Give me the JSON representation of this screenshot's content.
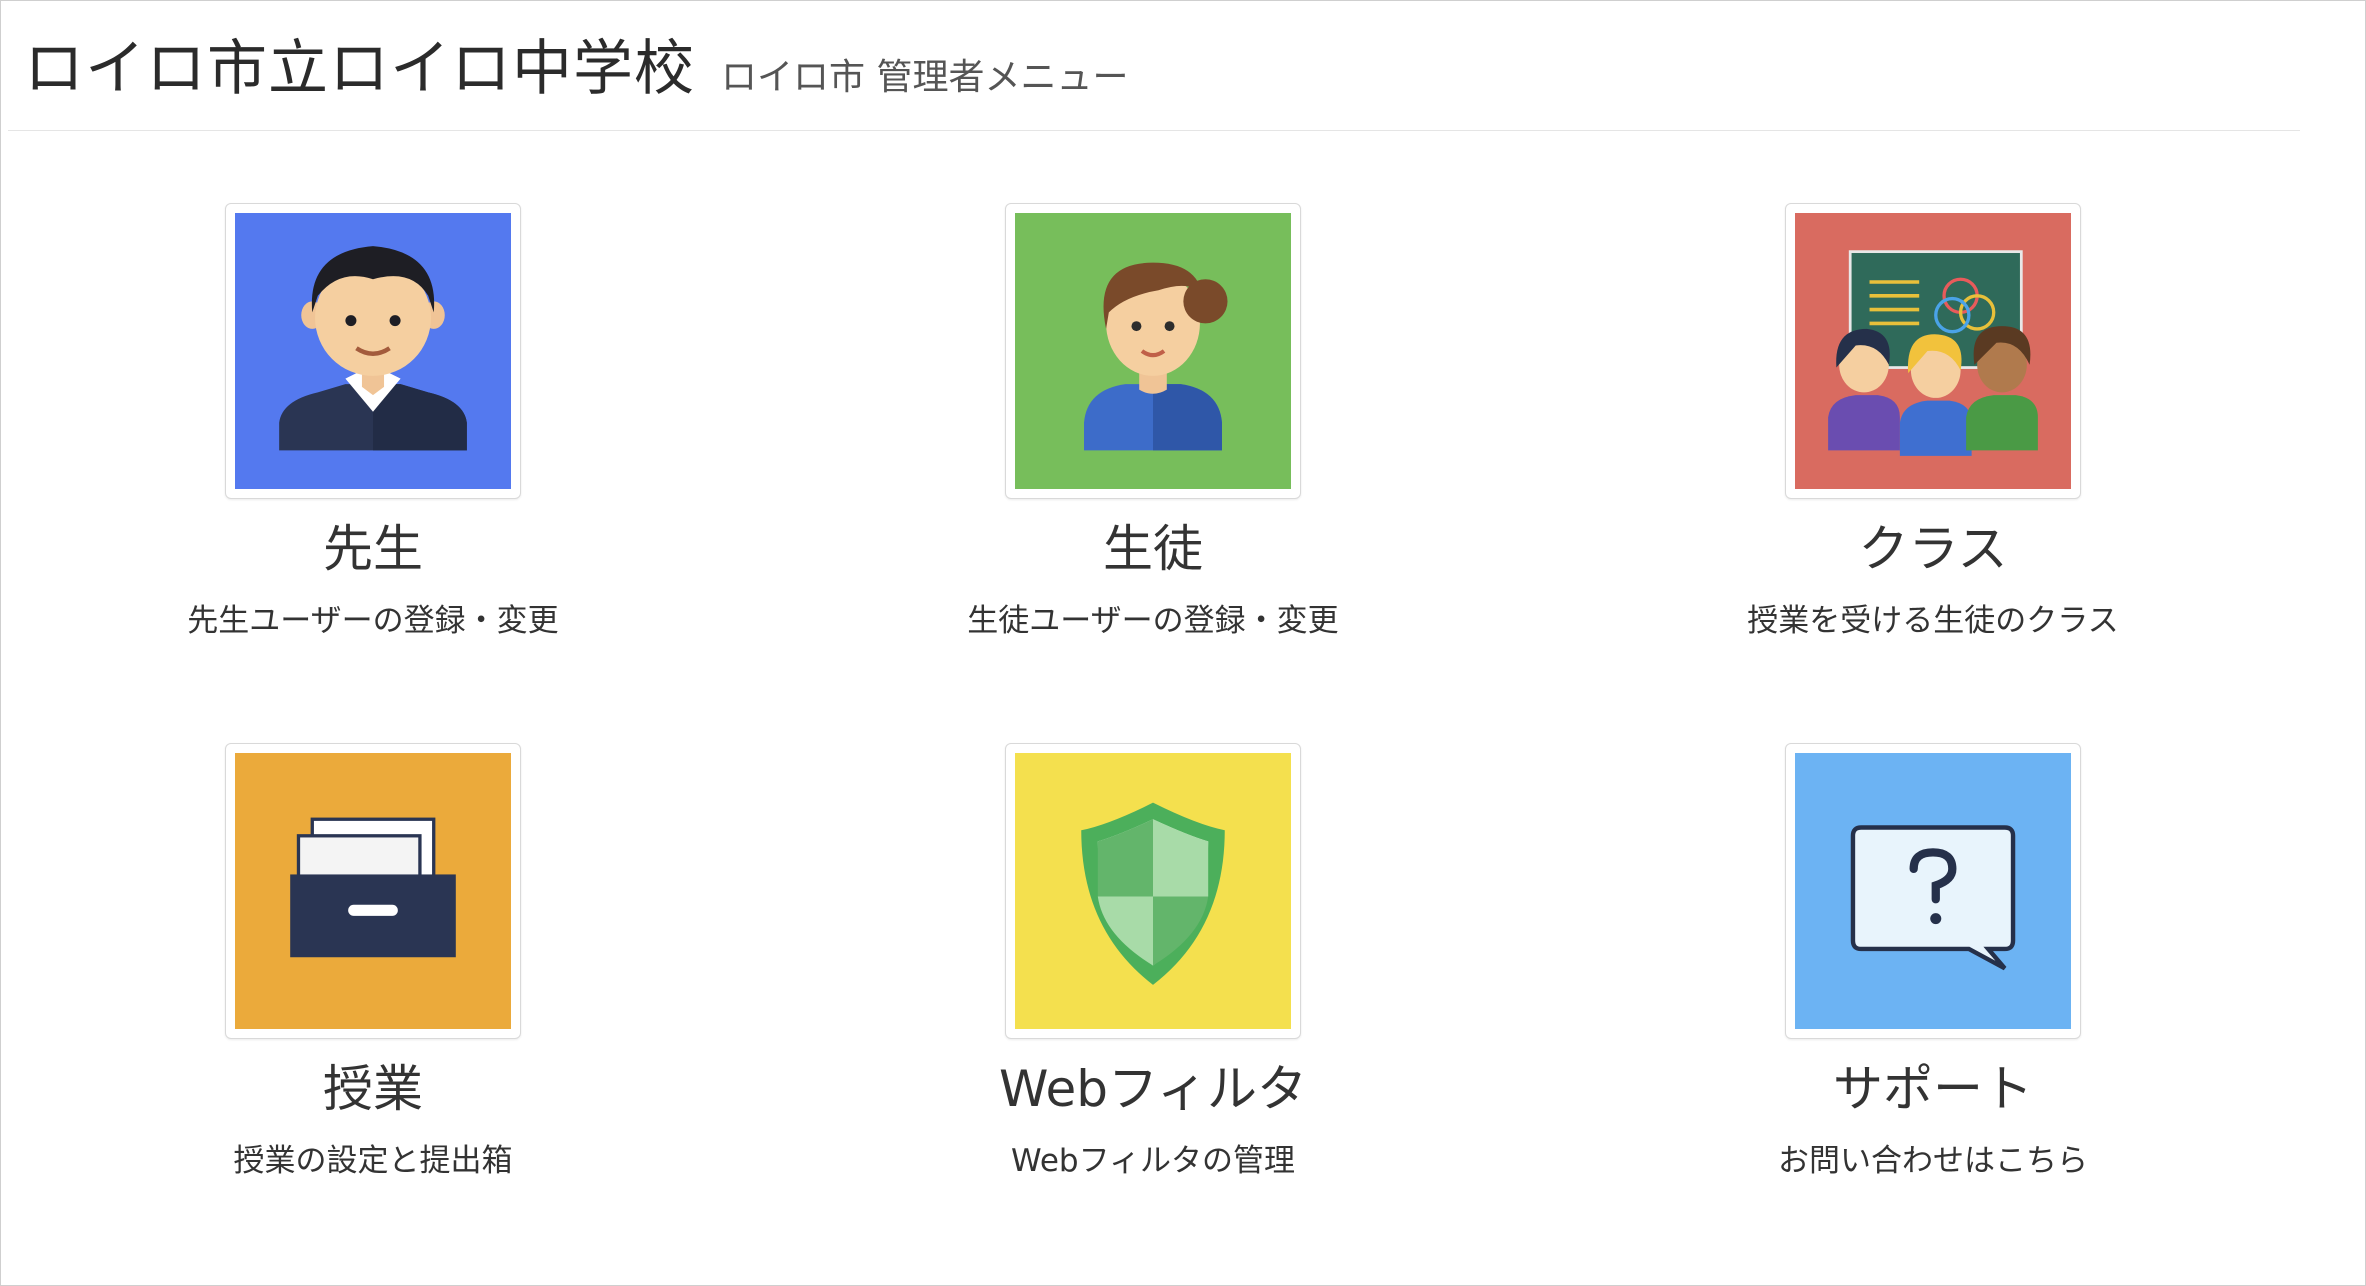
{
  "header": {
    "school_name": "ロイロ市立ロイロ中学校",
    "subtitle": "ロイロ市 管理者メニュー"
  },
  "colors": {
    "teacher": "#5479ef",
    "student": "#77be5b",
    "class": "#d96b60",
    "lesson": "#ebaa3b",
    "webfilter": "#f4e04e",
    "support": "#6cb3f3"
  },
  "menu": [
    {
      "title": "先生",
      "desc": "先生ユーザーの登録・変更",
      "icon": "teacher-icon"
    },
    {
      "title": "生徒",
      "desc": "生徒ユーザーの登録・変更",
      "icon": "student-icon"
    },
    {
      "title": "クラス",
      "desc": "授業を受ける生徒のクラス",
      "icon": "classroom-icon"
    },
    {
      "title": "授業",
      "desc": "授業の設定と提出箱",
      "icon": "inbox-drawer-icon"
    },
    {
      "title": "Webフィルタ",
      "desc": "Webフィルタの管理",
      "icon": "shield-icon"
    },
    {
      "title": "サポート",
      "desc": "お問い合わせはこちら",
      "icon": "question-bubble-icon"
    }
  ]
}
